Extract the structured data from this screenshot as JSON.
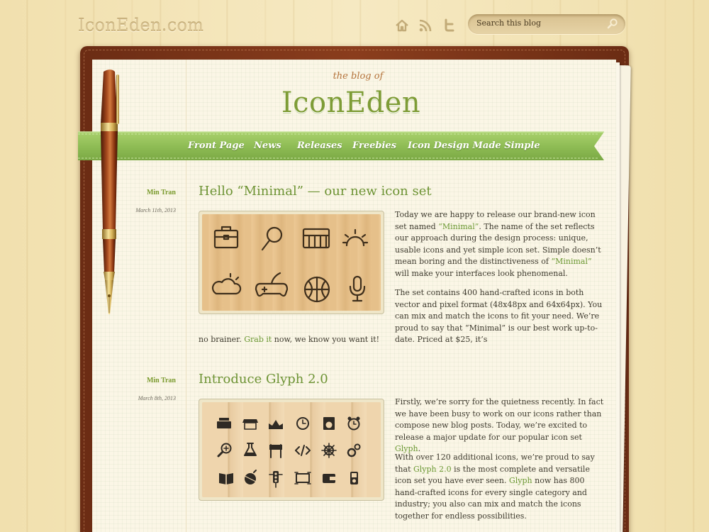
{
  "header": {
    "logo": "IconEden.com",
    "search_placeholder": "Search this blog",
    "icons": [
      "home-icon",
      "rss-icon",
      "twitter-icon"
    ]
  },
  "masthead": {
    "tagline": "the blog of",
    "title": "IconEden"
  },
  "nav": {
    "items": [
      "Front Page",
      "News",
      "Releases",
      "Freebies",
      "Icon Design Made Simple"
    ]
  },
  "colors": {
    "accent": "#6d9334",
    "ribbon": "#95c25b",
    "leather": "#7a351a"
  },
  "posts": [
    {
      "author": "Min Tran",
      "date": "March 11th, 2013",
      "title": "Hello “Minimal” — our new icon set",
      "image_icons": [
        "briefcase-icon",
        "magnifier-icon",
        "keyboard-icon",
        "sun-icon",
        "cloudy-icon",
        "gamepad-icon",
        "basketball-icon",
        "microphone-icon"
      ],
      "p1": {
        "a": "Today we are happy to release our brand-new icon set named ",
        "l1": "“Minimal”",
        "b": ". The name of the set reflects our approach during the design process: unique, usable icons and yet simple icon set. Simple doesn’t mean boring and the distinctiveness of ",
        "l2": "“Minimal”",
        "c": " will make your interfaces look phenomenal."
      },
      "p2": "The set contains 400 hand-crafted icons in both vector and pixel format (48x48px and 64x64px). You can mix and match the icons to fit your need. We’re proud to say that “Minimal” is our best work up-to-date. Priced at $25, it’s",
      "p3": {
        "a": "no brainer. ",
        "l": "Grab it",
        "b": " now, we know you want it!"
      }
    },
    {
      "author": "Min Tran",
      "date": "March 8th, 2013",
      "title": "Introduce Glyph 2.0",
      "image_icons": [
        "typewriter-icon",
        "shop-icon",
        "crown-icon",
        "clock-icon",
        "washer-icon",
        "alarm-clock-icon",
        "zoom-in-icon",
        "flask-icon",
        "barrier-icon",
        "code-icon",
        "helm-icon",
        "gears-icon",
        "book-icon",
        "ornament-icon",
        "traffic-light-icon",
        "screen-icon",
        "wallet-icon",
        "ipod-icon"
      ],
      "p1": {
        "a": "Firstly, we’re sorry for the quietness recently. In fact we have been busy to work on our icons rather than compose new blog posts. Today, we’re excited to release a major update for our popular icon set ",
        "l": "Glyph",
        "b": "."
      },
      "p2": {
        "a": "With over 120 additional icons, we’re proud to say that ",
        "l1": "Glyph 2.0",
        "b": " is the most complete and versatile icon set you have ever seen. ",
        "l2": "Glyph",
        "c": " now has 800 hand-crafted icons for every single category and industry; you also can mix and match the icons together for endless possibilities."
      }
    }
  ]
}
